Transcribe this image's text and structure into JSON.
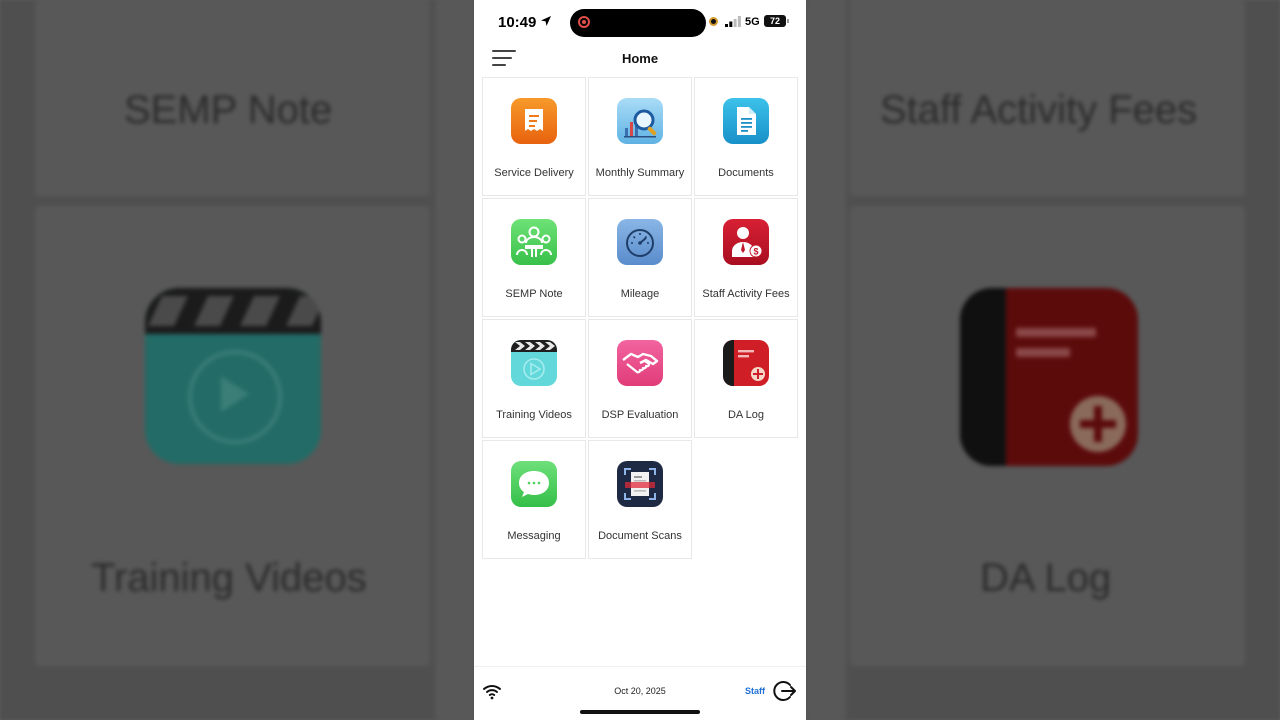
{
  "status_bar": {
    "time": "10:49",
    "network": "5G",
    "battery": "72"
  },
  "header": {
    "title": "Home"
  },
  "tiles": [
    {
      "label": "Service Delivery",
      "icon": "service-delivery-icon",
      "color": "#f07a1a"
    },
    {
      "label": "Monthly Summary",
      "icon": "monthly-summary-icon",
      "color": "#7fc4ec"
    },
    {
      "label": "Documents",
      "icon": "documents-icon",
      "color": "#2aa8d8"
    },
    {
      "label": "SEMP Note",
      "icon": "semp-note-icon",
      "color": "#4fd45e"
    },
    {
      "label": "Mileage",
      "icon": "mileage-icon",
      "color": "#6e9ed8"
    },
    {
      "label": "Staff Activity Fees",
      "icon": "staff-activity-fees-icon",
      "color": "#c0182c"
    },
    {
      "label": "Training Videos",
      "icon": "training-videos-icon",
      "color": "#5bd6d6"
    },
    {
      "label": "DSP Evaluation",
      "icon": "dsp-evaluation-icon",
      "color": "#ec4a86"
    },
    {
      "label": "DA Log",
      "icon": "da-log-icon",
      "color": "#d01e26"
    },
    {
      "label": "Messaging",
      "icon": "messaging-icon",
      "color": "#4fcf5a"
    },
    {
      "label": "Document Scans",
      "icon": "document-scans-icon",
      "color": "#1e2a44"
    }
  ],
  "footer": {
    "date": "Oct 20, 2025",
    "role": "Staff"
  },
  "background": {
    "texts": [
      "SEMP Note",
      "Staff Activity Fees",
      "Training Videos",
      "DA Log"
    ]
  }
}
